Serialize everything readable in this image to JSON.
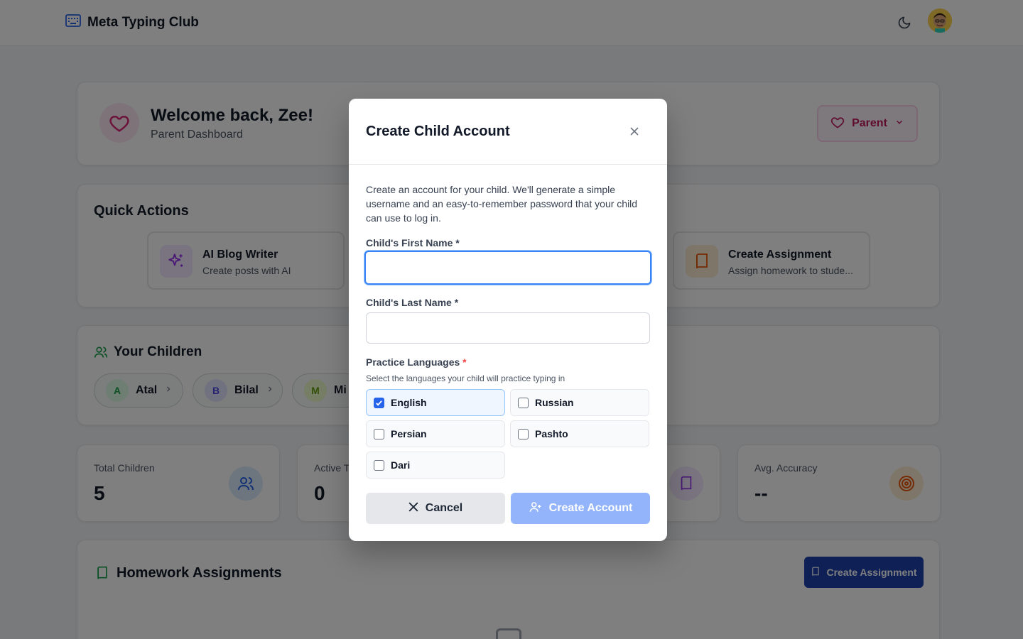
{
  "header": {
    "app_name": "Meta Typing Club"
  },
  "welcome": {
    "title": "Welcome back, Zee!",
    "subtitle": "Parent Dashboard",
    "role_label": "Parent"
  },
  "quick_actions": {
    "title": "Quick Actions",
    "items": [
      {
        "title": "AI Blog Writer",
        "subtitle": "Create posts with AI"
      },
      {
        "title": "Create Assignment",
        "subtitle": "Assign homework to stude..."
      }
    ]
  },
  "children": {
    "title": "Your Children",
    "items": [
      {
        "initial": "A",
        "name": "Atal"
      },
      {
        "initial": "B",
        "name": "Bilal"
      },
      {
        "initial": "M",
        "name": "Mi"
      }
    ]
  },
  "stats": [
    {
      "label": "Total Children",
      "value": "5"
    },
    {
      "label": "Active T",
      "value": "0"
    },
    {
      "label": "Avg. Accuracy",
      "value": "--"
    }
  ],
  "homework": {
    "title": "Homework Assignments",
    "button_label": "Create Assignment"
  },
  "modal": {
    "title": "Create Child Account",
    "description": "Create an account for your child. We'll generate a simple username and an easy-to-remember password that your child can use to log in.",
    "first_name_label": "Child's First Name",
    "first_name_value": "",
    "last_name_label": "Child's Last Name",
    "last_name_value": "",
    "required_mark": "*",
    "languages_label": "Practice Languages",
    "languages_help": "Select the languages your child will practice typing in",
    "languages": [
      {
        "name": "English",
        "checked": true
      },
      {
        "name": "Russian",
        "checked": false
      },
      {
        "name": "Persian",
        "checked": false
      },
      {
        "name": "Pashto",
        "checked": false
      },
      {
        "name": "Dari",
        "checked": false
      }
    ],
    "cancel_label": "Cancel",
    "create_label": "Create Account"
  },
  "colors": {
    "accent": "#2563eb",
    "create_disabled": "#93b4fa",
    "overlay": "rgba(0,0,0,0.5)",
    "brand_pink": "#be185d"
  }
}
